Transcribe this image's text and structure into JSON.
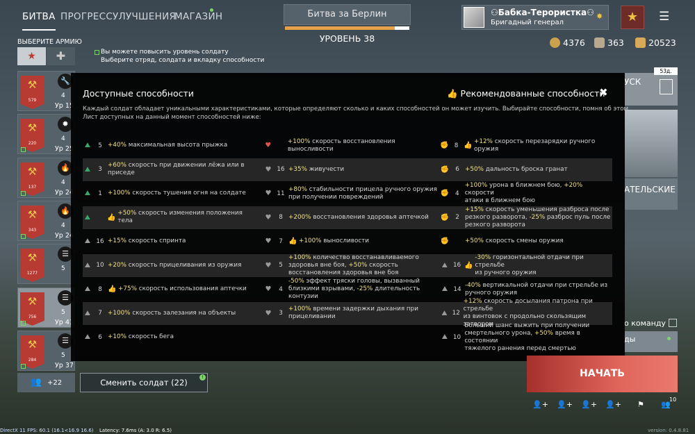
{
  "nav": {
    "tabs": [
      "БИТВА",
      "ПРОГРЕСС",
      "УЛУЧШЕНИЯ",
      "МАГАЗИН"
    ]
  },
  "battle": {
    "title": "Битва за Берлин",
    "level": "УРОВЕНЬ 38",
    "progress": 0.88
  },
  "player": {
    "name": "⚇Бабка-Терористка⚇",
    "rank": "Бригадный генерал"
  },
  "currency": {
    "silver": "4376",
    "orders": "363",
    "gold": "20523"
  },
  "left": {
    "choose_army": "ВЫБЕРИТЕ АРМИЮ",
    "hint_line1": "Вы можете повысить уровень солдату",
    "hint_line2": "Выберите отряд, солдата и вкладку способности",
    "squads": [
      {
        "num": "579",
        "count": "4",
        "level": "Ур 15",
        "icon": "🔧"
      },
      {
        "num": "220",
        "count": "4",
        "level": "Ур 25",
        "icon": "✹"
      },
      {
        "num": "137",
        "count": "4",
        "level": "Ур 24",
        "icon": "🔥"
      },
      {
        "num": "343",
        "count": "4",
        "level": "Ур 24",
        "icon": "🔥"
      },
      {
        "num": "1277",
        "count": "5",
        "level": "",
        "icon": "☰"
      },
      {
        "num": "756",
        "count": "5",
        "level": "Ур 41",
        "icon": "☰"
      },
      {
        "num": "284",
        "count": "5",
        "level": "Ур 37",
        "icon": "☰"
      }
    ],
    "reserve": "+22"
  },
  "modal": {
    "title": "Доступные способности",
    "recommended": "Рекомендованные способности",
    "close": "✖",
    "desc1": "Каждый солдат обладает уникальными характеристиками, которые определяют сколько и каких способностей он может изучить. Выбирайте способности, помня об этом.",
    "desc2": "Лист доступных на данный момент способностей ниже:",
    "rows": [
      [
        {
          "n": "5",
          "t": "+40% максимальная высота прыжка",
          "thumb": false,
          "ic": "g"
        },
        {
          "n": "",
          "t": "+100% скорость восстановления выносливости",
          "thumb": false,
          "ic": "r"
        },
        {
          "n": "8",
          "t": "+12% скорость перезарядки ручного оружия",
          "thumb": true,
          "ic": "y"
        }
      ],
      [
        {
          "n": "3",
          "t": "+60% скорость при движении лёжа или в\nприседе",
          "thumb": false,
          "ic": "g"
        },
        {
          "n": "16",
          "t": "+35% живучести",
          "thumb": false,
          "ic": "gr"
        },
        {
          "n": "6",
          "t": "+50% дальность броска гранат",
          "thumb": false,
          "ic": "y"
        }
      ],
      [
        {
          "n": "1",
          "t": "+100% скорость тушения огня на солдате",
          "thumb": false,
          "ic": "g"
        },
        {
          "n": "11",
          "t": "+80% стабильности прицела ручного оружия\nпри получении повреждений",
          "thumb": false,
          "ic": "gr"
        },
        {
          "n": "4",
          "t": "+100% урона в ближнем бою, +20% скорости\nатаки в ближнем бою",
          "thumb": false,
          "ic": "y"
        }
      ],
      [
        {
          "n": "",
          "t": "+50% скорость изменения положения тела",
          "thumb": true,
          "ic": "g"
        },
        {
          "n": "8",
          "t": "+200% восстановления здоровья аптечкой",
          "thumb": false,
          "ic": "gr"
        },
        {
          "n": "2",
          "t": "+15% скорость уменьшения разброса после\nрезкого разворота, -25% разброс пуль после\nрезкого разворота",
          "thumb": false,
          "ic": "y"
        }
      ],
      [
        {
          "n": "16",
          "t": "+15% скорость спринта",
          "thumb": false,
          "ic": "gr"
        },
        {
          "n": "7",
          "t": "+100% выносливости",
          "thumb": true,
          "ic": "gr"
        },
        {
          "n": "",
          "t": "+50% скорость смены оружия",
          "thumb": false,
          "ic": "y"
        }
      ],
      [
        {
          "n": "10",
          "t": "+20% скорость прицеливания из оружия",
          "thumb": false,
          "ic": "gr"
        },
        {
          "n": "5",
          "t": "+100% количество восстанавливаемого\nздоровья вне боя, +50% скорость\nвосстановления здоровья вне боя",
          "thumb": false,
          "ic": "gr"
        },
        {
          "n": "16",
          "t": "-30% горизонтальной отдачи при стрельбе\nиз ручного оружия",
          "thumb": true,
          "ic": "gr"
        }
      ],
      [
        {
          "n": "8",
          "t": "+75% скорость использования аптечки",
          "thumb": true,
          "ic": "gr"
        },
        {
          "n": "4",
          "t": "-50% эффект тряски головы, вызванный\nблизкими взрывами, -25% длительность\nконтузии",
          "thumb": false,
          "ic": "gr"
        },
        {
          "n": "14",
          "t": "-40% вертикальной отдачи при стрельбе из\nручного оружия",
          "thumb": false,
          "ic": "gr"
        }
      ],
      [
        {
          "n": "7",
          "t": "+100% скорость залезания на объекты",
          "thumb": false,
          "ic": "gr"
        },
        {
          "n": "3",
          "t": "+100% времени задержки дыхания при\nприцеливании",
          "thumb": false,
          "ic": "gr"
        },
        {
          "n": "12",
          "t": "+12% скорость досылания патрона при стрельбе\nиз винтовок с продольно скользящим затвором",
          "thumb": false,
          "ic": "gr"
        }
      ],
      [
        {
          "n": "6",
          "t": "+10% скорость бега",
          "thumb": false,
          "ic": "gr"
        },
        {
          "n": "",
          "t": "",
          "thumb": false,
          "ic": ""
        },
        {
          "n": "10",
          "t": "Больший шанс выжить при получении\nсмертельного урона, +50% время в состоянии\nтяжелого ранения перед смертью",
          "thumb": false,
          "ic": "gr"
        }
      ]
    ]
  },
  "bottom": {
    "change_soldier": "Сменить солдат (22)",
    "start": "НАЧАТЬ",
    "badge": "10",
    "change_badge": "!"
  },
  "right": {
    "timer": "53д.",
    "text1": "УСК",
    "text2": "АТЕЛЬСКИЕ",
    "team": "о команду",
    "text3": "ды"
  },
  "debug": {
    "fps": "DirectX 11 FPS: 60.1 (16.1<16.9 16.6)",
    "latency": "Latency:  7.6ms (A:  3.0 R:  6.5)",
    "version": "version: 0.4.8.81"
  }
}
